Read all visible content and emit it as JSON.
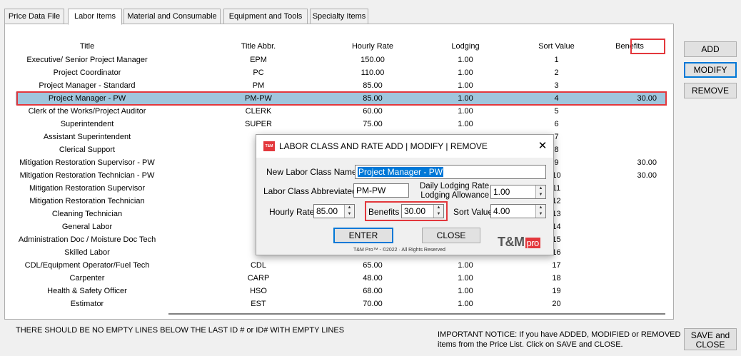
{
  "tabs": [
    {
      "label": "Price Data File",
      "active": false
    },
    {
      "label": "Labor Items",
      "active": true
    },
    {
      "label": "Material and Consumable",
      "active": false
    },
    {
      "label": "Equipment and Tools",
      "active": false
    },
    {
      "label": "Specialty Items",
      "active": false
    }
  ],
  "grid": {
    "headers": {
      "title": "Title",
      "abbr": "Title Abbr.",
      "rate": "Hourly Rate",
      "lodging": "Lodging",
      "sort": "Sort Value",
      "benefits": "Benefits"
    },
    "rows": [
      {
        "title": "Executive/ Senior Project Manager",
        "abbr": "EPM",
        "rate": "150.00",
        "lodging": "1.00",
        "sort": "1",
        "benefits": ""
      },
      {
        "title": "Project Coordinator",
        "abbr": "PC",
        "rate": "110.00",
        "lodging": "1.00",
        "sort": "2",
        "benefits": ""
      },
      {
        "title": "Project Manager - Standard",
        "abbr": "PM",
        "rate": "85.00",
        "lodging": "1.00",
        "sort": "3",
        "benefits": ""
      },
      {
        "title": "Project Manager - PW",
        "abbr": "PM-PW",
        "rate": "85.00",
        "lodging": "1.00",
        "sort": "4",
        "benefits": "30.00",
        "selected": true
      },
      {
        "title": "Clerk of the Works/Project Auditor",
        "abbr": "CLERK",
        "rate": "60.00",
        "lodging": "1.00",
        "sort": "5",
        "benefits": ""
      },
      {
        "title": "Superintendent",
        "abbr": "SUPER",
        "rate": "75.00",
        "lodging": "1.00",
        "sort": "6",
        "benefits": ""
      },
      {
        "title": "Assistant Superintendent",
        "abbr": "",
        "rate": "",
        "lodging": "",
        "sort": "7",
        "benefits": ""
      },
      {
        "title": "Clerical Support",
        "abbr": "",
        "rate": "",
        "lodging": "",
        "sort": "8",
        "benefits": ""
      },
      {
        "title": "Mitigation Restoration Supervisor - PW",
        "abbr": "",
        "rate": "",
        "lodging": "",
        "sort": "9",
        "benefits": "30.00"
      },
      {
        "title": "Mitigation Restoration Technician - PW",
        "abbr": "",
        "rate": "",
        "lodging": "",
        "sort": "10",
        "benefits": "30.00"
      },
      {
        "title": "Mitigation Restoration Supervisor",
        "abbr": "",
        "rate": "",
        "lodging": "",
        "sort": "11",
        "benefits": ""
      },
      {
        "title": "Mitigation Restoration Technician",
        "abbr": "",
        "rate": "",
        "lodging": "",
        "sort": "12",
        "benefits": ""
      },
      {
        "title": "Cleaning Technician",
        "abbr": "",
        "rate": "",
        "lodging": "",
        "sort": "13",
        "benefits": ""
      },
      {
        "title": "General Labor",
        "abbr": "",
        "rate": "",
        "lodging": "",
        "sort": "14",
        "benefits": ""
      },
      {
        "title": "Administration Doc / Moisture Doc Tech",
        "abbr": "",
        "rate": "",
        "lodging": "",
        "sort": "15",
        "benefits": ""
      },
      {
        "title": "Skilled Labor",
        "abbr": "",
        "rate": "",
        "lodging": "",
        "sort": "16",
        "benefits": ""
      },
      {
        "title": "CDL/Equipment Operator/Fuel Tech",
        "abbr": "CDL",
        "rate": "65.00",
        "lodging": "1.00",
        "sort": "17",
        "benefits": ""
      },
      {
        "title": "Carpenter",
        "abbr": "CARP",
        "rate": "48.00",
        "lodging": "1.00",
        "sort": "18",
        "benefits": ""
      },
      {
        "title": "Health & Safety Officer",
        "abbr": "HSO",
        "rate": "68.00",
        "lodging": "1.00",
        "sort": "19",
        "benefits": ""
      },
      {
        "title": "Estimator",
        "abbr": "EST",
        "rate": "70.00",
        "lodging": "1.00",
        "sort": "20",
        "benefits": ""
      }
    ]
  },
  "side_buttons": {
    "add": "ADD",
    "modify": "MODIFY",
    "remove": "REMOVE"
  },
  "footer": {
    "warning": "THERE SHOULD BE NO EMPTY LINES BELOW THE LAST ID # or ID# WITH EMPTY LINES",
    "notice_line1": "IMPORTANT NOTICE:  If you have ADDED, MODIFIED or REMOVED",
    "notice_line2": "items from the Price List.  Click on SAVE and CLOSE.",
    "save_close_line1": "SAVE and",
    "save_close_line2": "CLOSE"
  },
  "dialog": {
    "title": "LABOR CLASS AND RATE ADD | MODIFY | REMOVE",
    "logo_text": "T&M",
    "new_class_label": "New Labor Class Name",
    "new_class_value": "Project Manager - PW",
    "abbr_label": "Labor Class Abbreviated",
    "abbr_value": "PM-PW",
    "lodging_label_line1": "Daily Lodging Rate",
    "lodging_label_line2": "Lodging Allowance",
    "lodging_value": "1.00",
    "hourly_label": "Hourly Rate",
    "hourly_value": "85.00",
    "benefits_label": "Benefits",
    "benefits_value": "30.00",
    "sort_label": "Sort Value",
    "sort_value": "4.00",
    "enter_label": "ENTER",
    "close_label": "CLOSE",
    "brand": "T&M",
    "brand_pro": "pro",
    "copyright": "T&M Pro™ - ©2022 · All Rights Reserved"
  },
  "colors": {
    "highlight": "#e3373c",
    "selected_row": "#9fc6dd",
    "focus": "#0078d7"
  }
}
